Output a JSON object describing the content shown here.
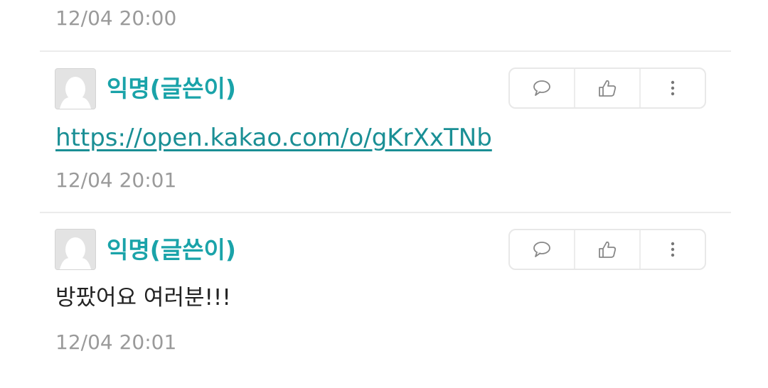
{
  "comments": [
    {
      "timestamp": "12/04 20:00"
    },
    {
      "author": "익명(글쓴이)",
      "link": "https://open.kakao.com/o/gKrXxTNb",
      "timestamp": "12/04 20:01",
      "actions": [
        "comment-icon",
        "like-icon",
        "more-icon"
      ]
    },
    {
      "author": "익명(글쓴이)",
      "text": "방팠어요 여러분!!!",
      "timestamp": "12/04 20:01",
      "actions": [
        "comment-icon",
        "like-icon",
        "more-icon"
      ]
    }
  ],
  "colors": {
    "author": "#1aa3a9",
    "link": "#1a8f95",
    "timestamp": "#9a9a9a",
    "divider": "#ebebeb"
  }
}
